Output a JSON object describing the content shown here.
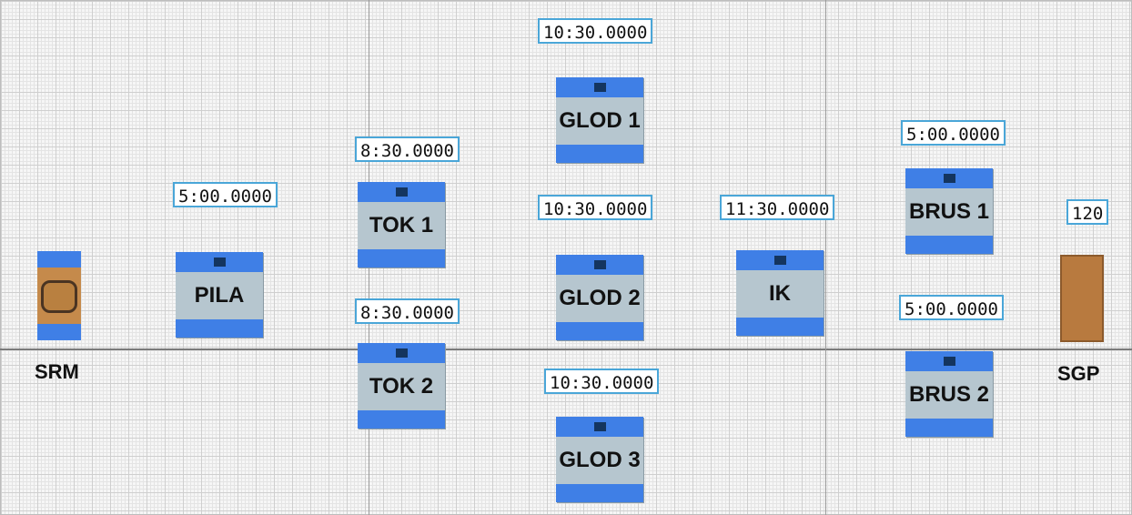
{
  "source": {
    "name": "SRM"
  },
  "sink": {
    "name": "SGP",
    "count": "120"
  },
  "machines": {
    "pila": {
      "label": "PILA",
      "time": "5:00.0000"
    },
    "tok1": {
      "label": "TOK 1",
      "time": "8:30.0000"
    },
    "tok2": {
      "label": "TOK 2",
      "time": "8:30.0000"
    },
    "glod1": {
      "label": "GLOD 1",
      "time": "10:30.0000"
    },
    "glod2": {
      "label": "GLOD 2",
      "time": "10:30.0000"
    },
    "glod3": {
      "label": "GLOD 3",
      "time": "10:30.0000"
    },
    "ik": {
      "label": "IK",
      "time": "11:30.0000"
    },
    "brus1": {
      "label": "BRUS 1",
      "time": "5:00.0000"
    },
    "brus2": {
      "label": "BRUS 2",
      "time": "5:00.0000"
    }
  },
  "colors": {
    "machine_body": "#b6c6cf",
    "machine_band": "#3f7fe6",
    "timer_border": "#4aa6d8",
    "source_fill": "#c58a4b",
    "sink_fill": "#b87a3f"
  }
}
